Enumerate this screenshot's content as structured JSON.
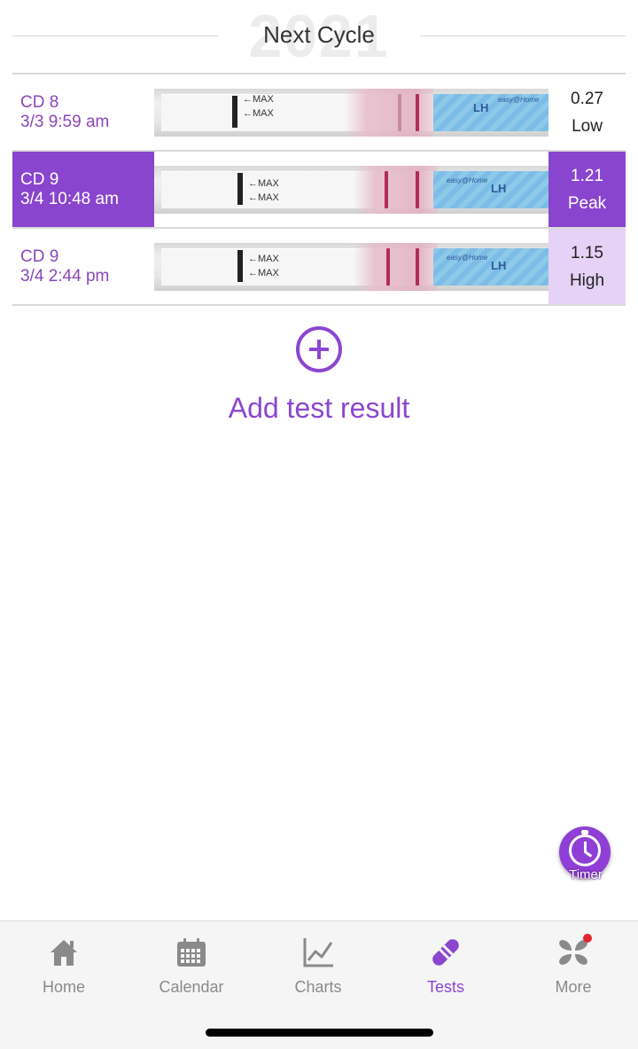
{
  "header": {
    "title": "Next Cycle",
    "watermark": "2021"
  },
  "rows": [
    {
      "cd": "CD 8",
      "datetime": "3/3 9:59 am",
      "value": "0.27",
      "level": "Low",
      "selected": false
    },
    {
      "cd": "CD 9",
      "datetime": "3/4 10:48 am",
      "value": "1.21",
      "level": "Peak",
      "selected": true
    },
    {
      "cd": "CD 9",
      "datetime": "3/4 2:44 pm",
      "value": "1.15",
      "level": "High",
      "selected": false
    }
  ],
  "strip": {
    "max_text": "←MAX",
    "brand_text": "LH",
    "brand_small": "easy@Home"
  },
  "add": {
    "label": "Add test result",
    "icon": "add-circle-icon"
  },
  "timer": {
    "label": "Timer",
    "icon": "stopwatch-icon"
  },
  "tabs": [
    {
      "label": "Home",
      "icon": "home-icon"
    },
    {
      "label": "Calendar",
      "icon": "calendar-icon"
    },
    {
      "label": "Charts",
      "icon": "chart-icon"
    },
    {
      "label": "Tests",
      "icon": "test-strip-icon"
    },
    {
      "label": "More",
      "icon": "more-icon"
    }
  ],
  "colors": {
    "accent": "#8a45cf",
    "high_bg": "#e6d2f6",
    "tab_inactive": "#8a8a8a"
  }
}
